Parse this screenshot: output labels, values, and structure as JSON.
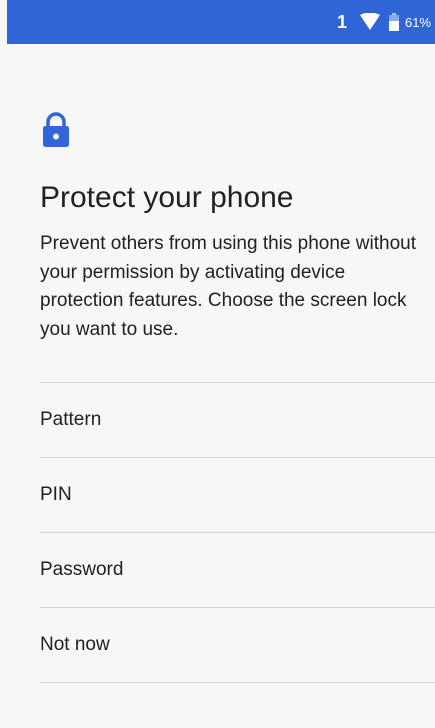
{
  "status_bar": {
    "notification_count": "1",
    "battery_percent": "61%",
    "icons": [
      "wifi-icon",
      "battery-icon"
    ],
    "background_color": "#2f65d6"
  },
  "header": {
    "icon": "lock-icon",
    "icon_color": "#2f65d6",
    "title": "Protect your phone",
    "description": "Prevent others from using this phone without your permission by activating device protection features. Choose the screen lock you want to use."
  },
  "options": [
    {
      "label": "Pattern"
    },
    {
      "label": "PIN"
    },
    {
      "label": "Password"
    },
    {
      "label": "Not now"
    }
  ]
}
